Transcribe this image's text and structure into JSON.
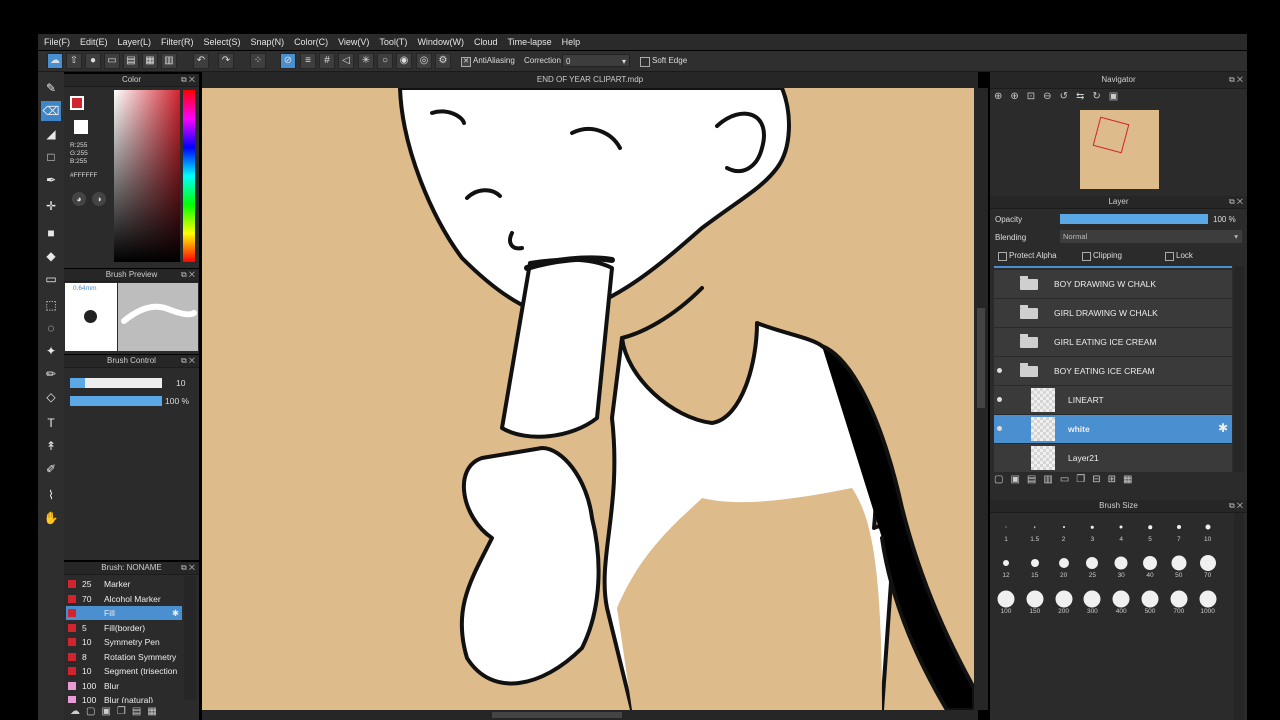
{
  "menu": [
    "File(F)",
    "Edit(E)",
    "Layer(L)",
    "Filter(R)",
    "Select(S)",
    "Snap(N)",
    "Color(C)",
    "View(V)",
    "Tool(T)",
    "Window(W)",
    "Cloud",
    "Time-lapse",
    "Help"
  ],
  "toolbar": {
    "antialiasing_label": "AntiAliasing",
    "correction_label": "Correction",
    "correction_value": "0",
    "soft_edge_label": "Soft Edge"
  },
  "canvas": {
    "title": "END OF YEAR CLIPART.mdp"
  },
  "color_panel": {
    "title": "Color",
    "r": "R:255",
    "g": "G:255",
    "b": "B:255",
    "hex": "#FFFFFF",
    "fg_color": "#d1242f",
    "bg_color": "#ffffff"
  },
  "brush_preview": {
    "title": "Brush Preview",
    "size_label": "0.64mm"
  },
  "brush_control": {
    "title": "Brush Control",
    "size_value": "10",
    "opacity_value": "100 %",
    "size_fraction": 0.16,
    "opacity_fraction": 1.0
  },
  "brush_list": {
    "title": "Brush: NONAME",
    "items": [
      {
        "size": "25",
        "name": "Marker",
        "color": "#d1242f"
      },
      {
        "size": "70",
        "name": "Alcohol Marker",
        "color": "#d1242f"
      },
      {
        "size": "",
        "name": "Fill",
        "color": "#d1242f",
        "selected": true
      },
      {
        "size": "5",
        "name": "Fill(border)",
        "color": "#d1242f"
      },
      {
        "size": "10",
        "name": "Symmetry Pen",
        "color": "#d1242f"
      },
      {
        "size": "8",
        "name": "Rotation Symmetry",
        "color": "#d1242f"
      },
      {
        "size": "10",
        "name": "Segment (trisection",
        "color": "#d1242f"
      },
      {
        "size": "100",
        "name": "Blur",
        "color": "#e89ad6"
      },
      {
        "size": "100",
        "name": "Blur (natural)",
        "color": "#e89ad6"
      }
    ]
  },
  "navigator": {
    "title": "Navigator"
  },
  "layer_panel": {
    "title": "Layer",
    "opacity_label": "Opacity",
    "opacity_value": "100 %",
    "opacity_fraction": 1.0,
    "blending_label": "Blending",
    "blending_value": "Normal",
    "protect_alpha": "Protect Alpha",
    "clipping": "Clipping",
    "lock": "Lock",
    "layers": [
      {
        "name": "BOY DRAWING W CHALK",
        "type": "folder"
      },
      {
        "name": "GIRL DRAWING W CHALK",
        "type": "folder"
      },
      {
        "name": "GIRL EATING ICE CREAM",
        "type": "folder"
      },
      {
        "name": "BOY EATING ICE CREAM",
        "type": "folder",
        "visible": true
      },
      {
        "name": "LINEART",
        "type": "layer",
        "visible": true
      },
      {
        "name": "white",
        "type": "layer",
        "visible": true,
        "selected": true
      },
      {
        "name": "Layer21",
        "type": "layer"
      }
    ]
  },
  "brush_size": {
    "title": "Brush Size",
    "sizes": [
      "1",
      "1.5",
      "2",
      "3",
      "4",
      "5",
      "7",
      "10",
      "12",
      "15",
      "20",
      "25",
      "30",
      "40",
      "50",
      "70",
      "100",
      "150",
      "200",
      "300",
      "400",
      "500",
      "700",
      "1000"
    ]
  }
}
